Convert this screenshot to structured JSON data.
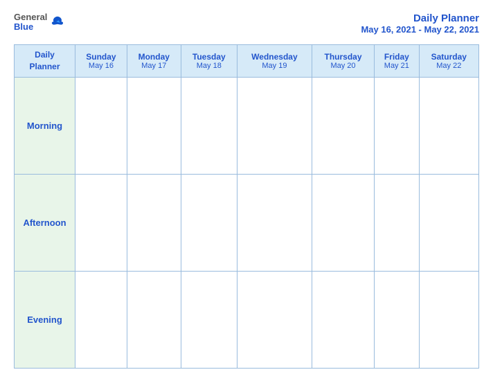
{
  "logo": {
    "general": "General",
    "blue": "Blue"
  },
  "title": {
    "main": "Daily Planner",
    "date_range": "May 16, 2021 - May 22, 2021"
  },
  "table": {
    "header_label": "Daily\nPlanner",
    "days": [
      {
        "name": "Sunday",
        "date": "May 16"
      },
      {
        "name": "Monday",
        "date": "May 17"
      },
      {
        "name": "Tuesday",
        "date": "May 18"
      },
      {
        "name": "Wednesday",
        "date": "May 19"
      },
      {
        "name": "Thursday",
        "date": "May 20"
      },
      {
        "name": "Friday",
        "date": "May 21"
      },
      {
        "name": "Saturday",
        "date": "May 22"
      }
    ],
    "rows": [
      {
        "label": "Morning"
      },
      {
        "label": "Afternoon"
      },
      {
        "label": "Evening"
      }
    ]
  }
}
